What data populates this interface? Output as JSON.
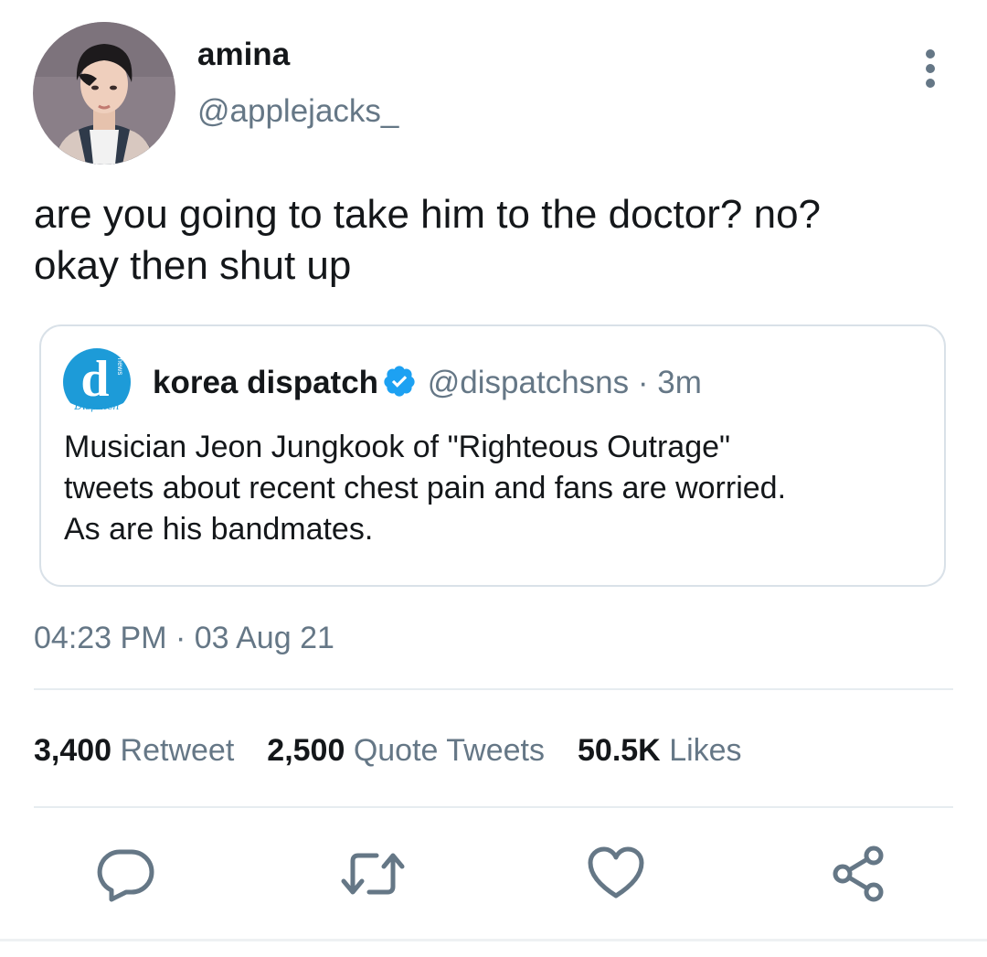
{
  "author": {
    "display_name": "amina",
    "handle": "@applejacks_"
  },
  "tweet": {
    "text_lines": [
      "are you going to take him to the doctor? no?",
      "okay then shut up"
    ],
    "timestamp": "04:23 PM · 03 Aug 21"
  },
  "quoted_tweet": {
    "display_name": "korea dispatch",
    "handle": "@dispatchsns",
    "time": "· 3m",
    "logo_letter": "d",
    "logo_badge": "news",
    "logo_script": "Dispatch",
    "text_lines": [
      "Musician Jeon Jungkook of \"Righteous Outrage\"",
      "tweets about recent chest pain and fans are worried.",
      "As are his bandmates."
    ]
  },
  "stats": {
    "retweets": {
      "count": "3,400",
      "label": "Retweet"
    },
    "quotes": {
      "count": "2,500",
      "label": "Quote Tweets"
    },
    "likes": {
      "count": "50.5K",
      "label": "Likes"
    }
  },
  "actions": {
    "reply_icon": "reply-icon",
    "retweet_icon": "retweet-icon",
    "like_icon": "heart-icon",
    "share_icon": "share-icon"
  },
  "colors": {
    "text_primary": "#14171a",
    "text_secondary": "#657786",
    "verified_blue": "#1da1f2",
    "border": "#d9e1e8",
    "icon_gray": "#657786"
  }
}
